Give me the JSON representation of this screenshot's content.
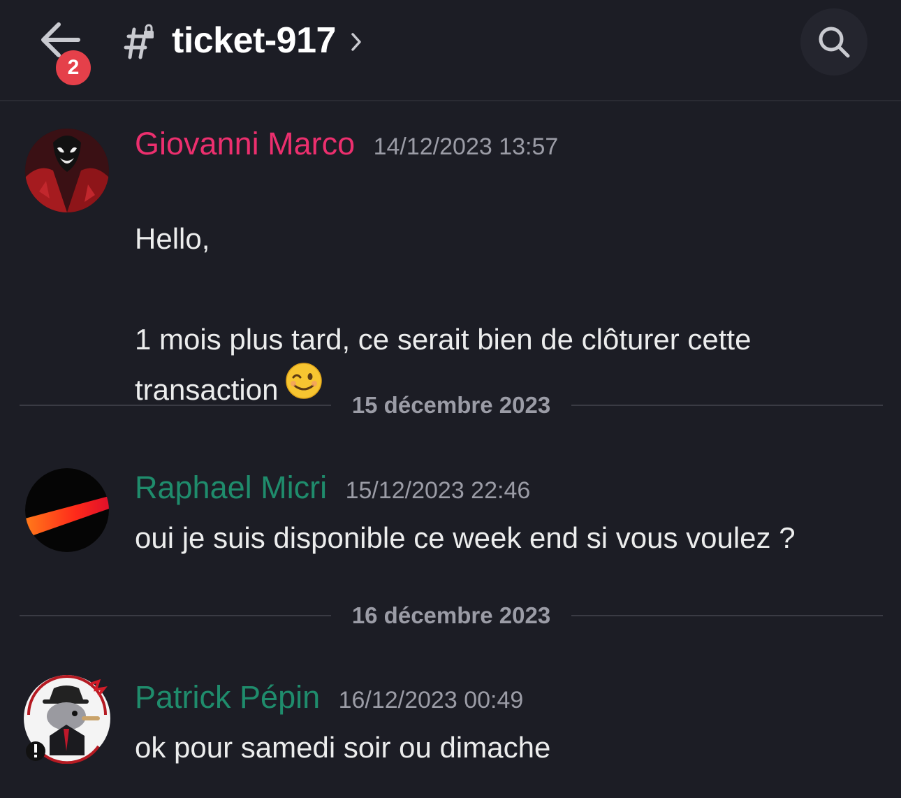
{
  "header": {
    "back_label": "Back",
    "unread_badge": "2",
    "channel_name": "ticket-917",
    "search_label": "Search"
  },
  "colors": {
    "background": "#1c1d25",
    "pink_author": "#ec2f6e",
    "green_author": "#1f8c6c",
    "badge": "#e5404a",
    "timestamp": "#9b9ca6"
  },
  "messages": [
    {
      "author": "Giovanni Marco",
      "author_color": "#ec2f6e",
      "timestamp": "14/12/2023 13:57",
      "text": "Hello,\n\n1 mois plus tard, ce serait bien de clôturer cette\ntransaction",
      "emoji": "winking-face"
    },
    {
      "author": "Raphael Micri",
      "author_color": "#1f8c6c",
      "timestamp": "15/12/2023 22:46",
      "text": "oui je suis disponible ce week end si vous voulez ?"
    },
    {
      "author": "Patrick Pépin",
      "author_color": "#1f8c6c",
      "timestamp": "16/12/2023 00:49",
      "text": "ok pour samedi soir ou dimache"
    }
  ],
  "dividers": [
    "15 décembre 2023",
    "16 décembre 2023"
  ]
}
